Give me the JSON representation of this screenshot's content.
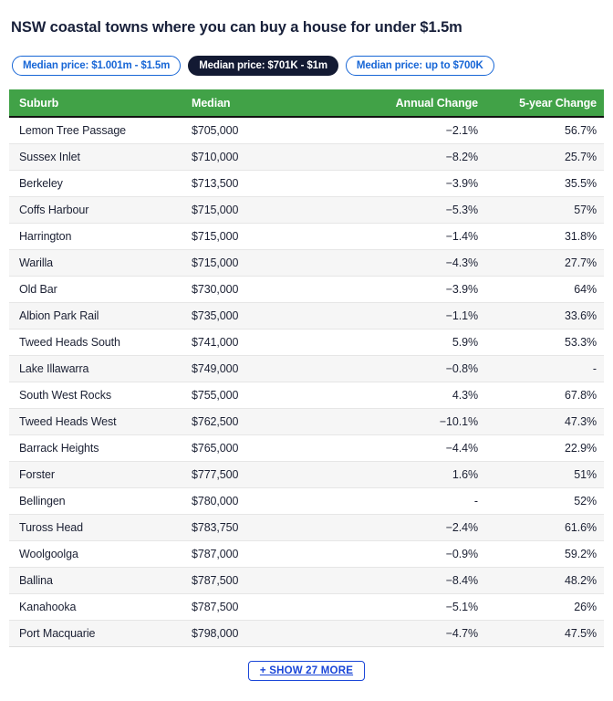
{
  "page_title": "NSW coastal towns where you can buy a house for under $1.5m",
  "filters": [
    {
      "label": "Median price: $1.001m - $1.5m",
      "active": false
    },
    {
      "label": "Median price: $701K - $1m",
      "active": true
    },
    {
      "label": "Median price: up to $700K",
      "active": false
    }
  ],
  "colors": {
    "header_green": "#41a247",
    "accent_blue": "#1766d6",
    "link_blue": "#1a46d8",
    "active_pill": "#131a33",
    "row_stripe": "#f6f6f6"
  },
  "table": {
    "columns": [
      "Suburb",
      "Median",
      "Annual Change",
      "5-year Change"
    ],
    "rows": [
      {
        "suburb": "Lemon Tree Passage",
        "median": "$705,000",
        "annual_change": "−2.1%",
        "five_year_change": "56.7%"
      },
      {
        "suburb": "Sussex Inlet",
        "median": "$710,000",
        "annual_change": "−8.2%",
        "five_year_change": "25.7%"
      },
      {
        "suburb": "Berkeley",
        "median": "$713,500",
        "annual_change": "−3.9%",
        "five_year_change": "35.5%"
      },
      {
        "suburb": "Coffs Harbour",
        "median": "$715,000",
        "annual_change": "−5.3%",
        "five_year_change": "57%"
      },
      {
        "suburb": "Harrington",
        "median": "$715,000",
        "annual_change": "−1.4%",
        "five_year_change": "31.8%"
      },
      {
        "suburb": "Warilla",
        "median": "$715,000",
        "annual_change": "−4.3%",
        "five_year_change": "27.7%"
      },
      {
        "suburb": "Old Bar",
        "median": "$730,000",
        "annual_change": "−3.9%",
        "five_year_change": "64%"
      },
      {
        "suburb": "Albion Park Rail",
        "median": "$735,000",
        "annual_change": "−1.1%",
        "five_year_change": "33.6%"
      },
      {
        "suburb": "Tweed Heads South",
        "median": "$741,000",
        "annual_change": "5.9%",
        "five_year_change": "53.3%"
      },
      {
        "suburb": "Lake Illawarra",
        "median": "$749,000",
        "annual_change": "−0.8%",
        "five_year_change": "-"
      },
      {
        "suburb": "South West Rocks",
        "median": "$755,000",
        "annual_change": "4.3%",
        "five_year_change": "67.8%"
      },
      {
        "suburb": "Tweed Heads West",
        "median": "$762,500",
        "annual_change": "−10.1%",
        "five_year_change": "47.3%"
      },
      {
        "suburb": "Barrack Heights",
        "median": "$765,000",
        "annual_change": "−4.4%",
        "five_year_change": "22.9%"
      },
      {
        "suburb": "Forster",
        "median": "$777,500",
        "annual_change": "1.6%",
        "five_year_change": "51%"
      },
      {
        "suburb": "Bellingen",
        "median": "$780,000",
        "annual_change": "-",
        "five_year_change": "52%"
      },
      {
        "suburb": "Tuross Head",
        "median": "$783,750",
        "annual_change": "−2.4%",
        "five_year_change": "61.6%"
      },
      {
        "suburb": "Woolgoolga",
        "median": "$787,000",
        "annual_change": "−0.9%",
        "five_year_change": "59.2%"
      },
      {
        "suburb": "Ballina",
        "median": "$787,500",
        "annual_change": "−8.4%",
        "five_year_change": "48.2%"
      },
      {
        "suburb": "Kanahooka",
        "median": "$787,500",
        "annual_change": "−5.1%",
        "five_year_change": "26%"
      },
      {
        "suburb": "Port Macquarie",
        "median": "$798,000",
        "annual_change": "−4.7%",
        "five_year_change": "47.5%"
      }
    ]
  },
  "show_more": {
    "label": "+ SHOW 27 MORE",
    "remaining_count": 27
  }
}
